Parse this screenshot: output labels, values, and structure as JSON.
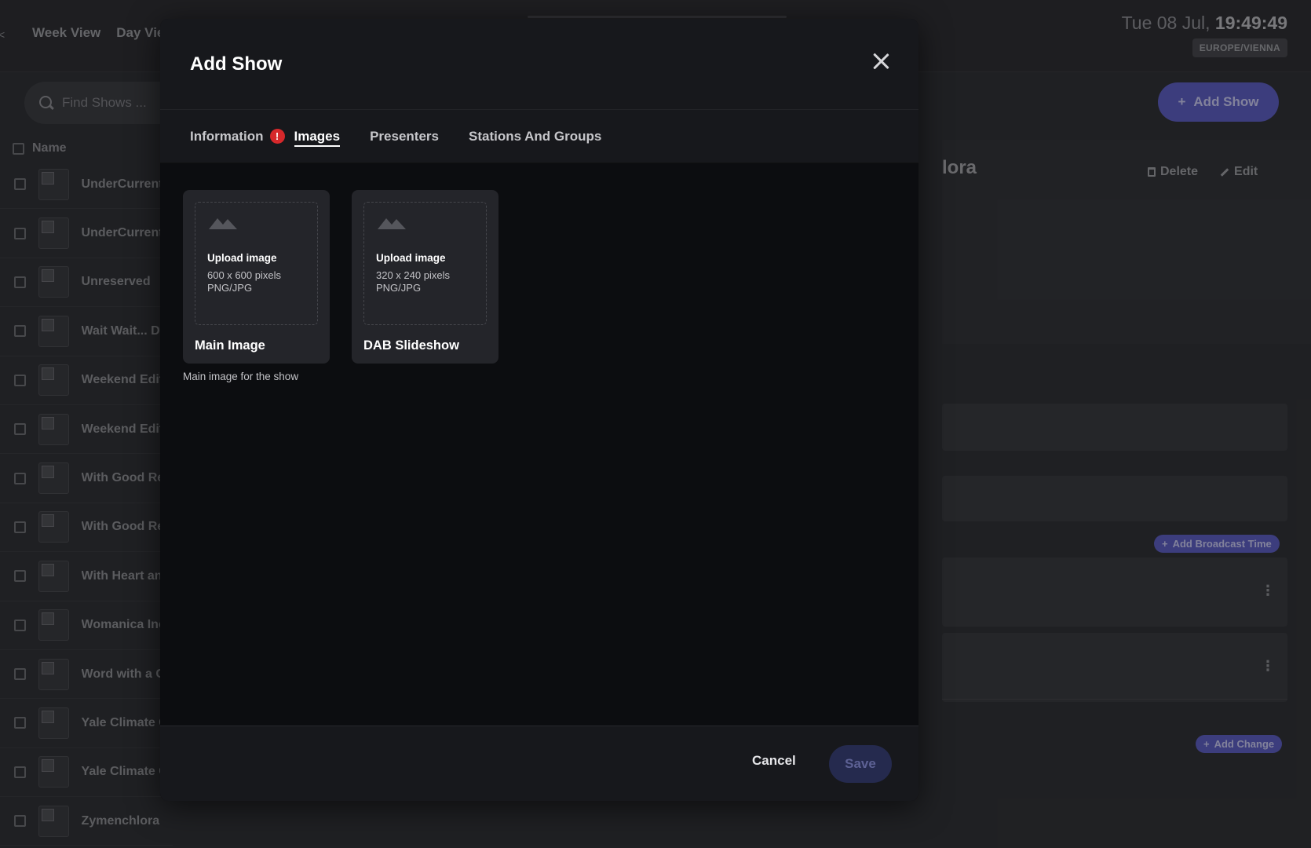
{
  "topbar": {
    "left_edge_glyph": "<",
    "view_tabs": [
      "Week View",
      "Day View"
    ],
    "clock_date": "Tue 08 Jul,",
    "clock_time": "19:49:49",
    "timezone": "EUROPE/VIENNA"
  },
  "sidebar": {
    "search_placeholder": "Find Shows ...",
    "column_name": "Name",
    "shows": [
      "UnderCurrents",
      "UnderCurrents",
      "Unreserved",
      "Wait Wait... Don't Tell Me",
      "Weekend Edition",
      "Weekend Edition",
      "With Good Reason",
      "With Good Reason",
      "With Heart and Soul",
      "Womanica Inc",
      "Word with a Cop",
      "Yale Climate Connections",
      "Yale Climate Connections",
      "Zymenchlora"
    ]
  },
  "detail": {
    "add_show_label": "Add Show",
    "title_fragment": "lora",
    "delete_label": "Delete",
    "edit_label": "Edit",
    "add_broadcast_time_label": "Add Broadcast Time",
    "add_change_label": "Add Change",
    "kebab_glyph": "⋮"
  },
  "modal": {
    "title": "Add Show",
    "tabs": {
      "information": "Information",
      "images": "Images",
      "presenters": "Presenters",
      "stations": "Stations And Groups"
    },
    "alert_glyph": "!",
    "cards": [
      {
        "upload_title": "Upload image",
        "size": "600 x 600 pixels",
        "format": "PNG/JPG",
        "label": "Main Image"
      },
      {
        "upload_title": "Upload image",
        "size": "320 x 240 pixels",
        "format": "PNG/JPG",
        "label": "DAB Slideshow"
      }
    ],
    "main_image_help": "Main image for the show",
    "cancel_label": "Cancel",
    "save_label": "Save"
  },
  "colors": {
    "accent": "#5d5ec0",
    "error": "#d6282b",
    "modal_bg": "#0c0d10",
    "modal_header_bg": "#17181c",
    "card_bg": "#24252a"
  }
}
